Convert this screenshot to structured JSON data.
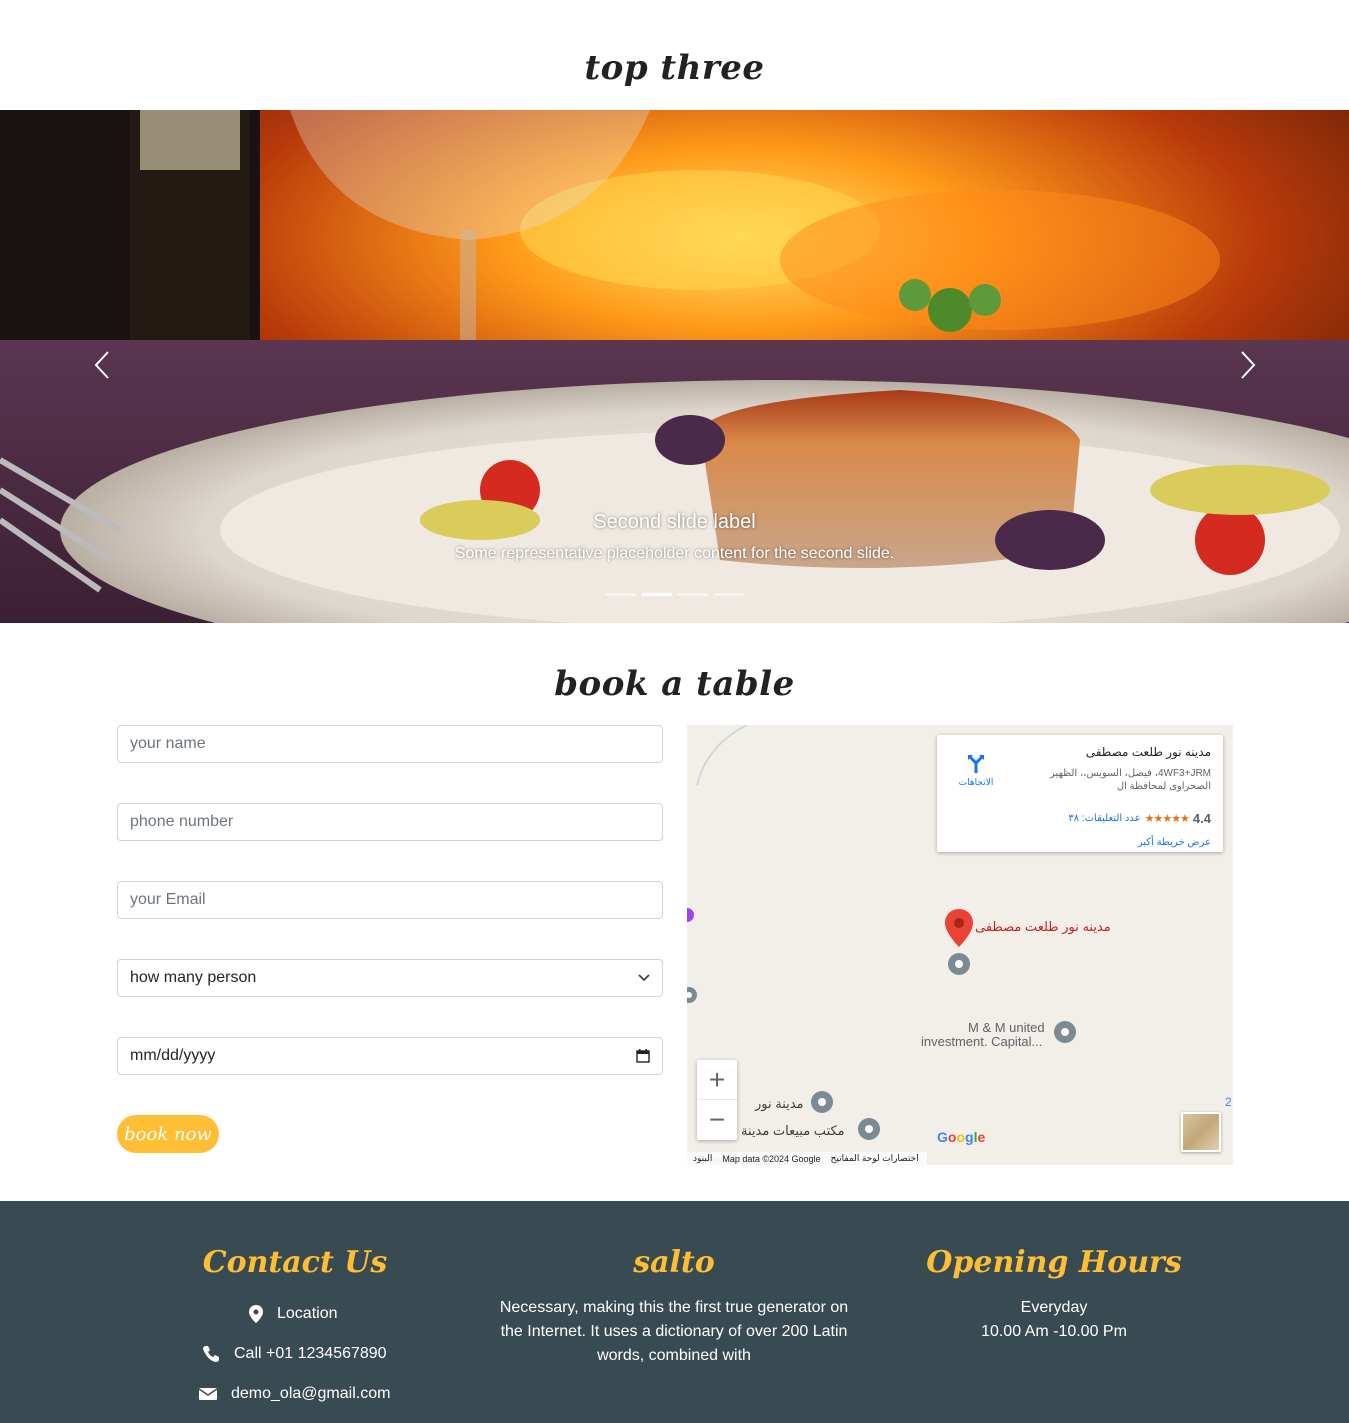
{
  "sections": {
    "top_title": "top three",
    "book_title": "book a table"
  },
  "carousel": {
    "caption_title": "Second slide label",
    "caption_text": "Some representative placeholder content for the second slide.",
    "slides_count": 4,
    "active_index": 1,
    "prev_icon": "chevron-left-icon",
    "next_icon": "chevron-right-icon"
  },
  "form": {
    "name_placeholder": "your name",
    "phone_placeholder": "phone number",
    "email_placeholder": "your Email",
    "persons_select": "how many person",
    "date_placeholder": "mm/dd/yyyy",
    "submit_label": "book now"
  },
  "map": {
    "place_name": "مدينه نور طلعت مصطفى",
    "address": "4WF3+JRM، فيصل، السويس،، الظهير الصحراوى لمحافظة ال",
    "rating": "4.4",
    "stars": "★★★★★",
    "reviews": "عدد التعليقات: ٣٨",
    "bigger_map": "عرض خريطة أكبر",
    "directions": "الاتجاهات",
    "pin_label": "مدينه نور طلعت مصطفى",
    "poi_1": "M & M united",
    "poi_1b": "investment. Capital...",
    "poi_2": "مدينة نور",
    "poi_3": "مكتب مبيعات مدينة",
    "zoom_in": "+",
    "zoom_out": "−",
    "footer_keyboard": "اختصارات لوحة المفاتيح",
    "footer_data": "Map data ©2024 Google",
    "footer_terms": "البنود",
    "google": "Google",
    "side_num": "2"
  },
  "footer": {
    "contact_title": "Contact Us",
    "location": "Location",
    "phone": "Call +01 1234567890",
    "email": "demo_ola@gmail.com",
    "brand_title": "salto",
    "brand_text": "Necessary, making this the first true generator on the Internet. It uses a dictionary of over 200 Latin words, combined with",
    "hours_title": "Opening Hours",
    "hours_day": "Everyday",
    "hours_time": "10.00 Am -10.00 Pm"
  },
  "colors": {
    "accent": "#ffbe33",
    "footer_bg": "#394b52"
  }
}
